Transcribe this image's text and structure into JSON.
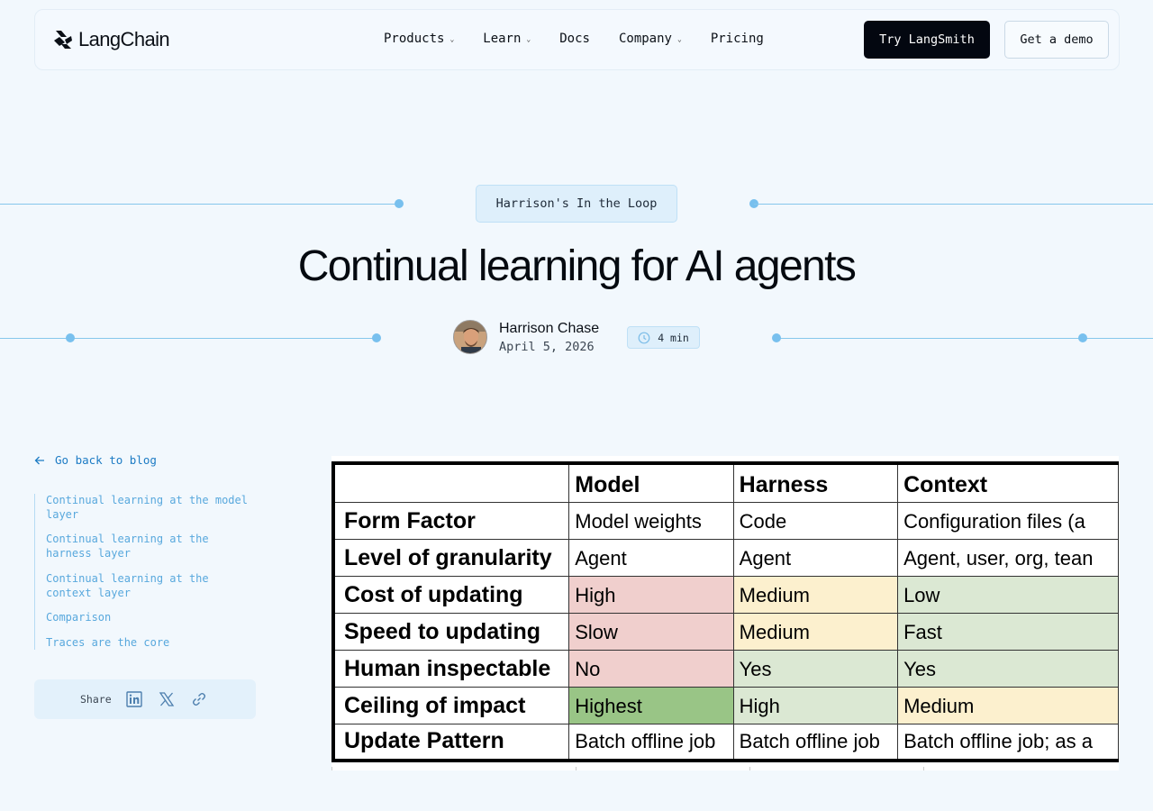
{
  "nav": {
    "logo_text": "LangChain",
    "menu": [
      {
        "label": "Products",
        "dropdown": true
      },
      {
        "label": "Learn",
        "dropdown": true
      },
      {
        "label": "Docs",
        "dropdown": false
      },
      {
        "label": "Company",
        "dropdown": true
      },
      {
        "label": "Pricing",
        "dropdown": false
      }
    ],
    "try_button": "Try LangSmith",
    "demo_button": "Get a demo"
  },
  "hero": {
    "tag": "Harrison's In the Loop",
    "title": "Continual learning for AI agents",
    "author_name": "Harrison Chase",
    "date": "April 5, 2026",
    "read_time": "4 min"
  },
  "sidebar": {
    "back_label": "Go back to blog",
    "toc": [
      {
        "label": "Continual learning at the model layer"
      },
      {
        "label": "Continual learning at the harness layer"
      },
      {
        "label": "Continual learning at the context layer"
      },
      {
        "label": "Comparison"
      },
      {
        "label": "Traces are the core"
      }
    ],
    "share_label": "Share"
  },
  "table": {
    "headers": [
      "",
      "Model",
      "Harness",
      "Context"
    ],
    "rows": [
      {
        "label": "Form Factor",
        "cells": [
          "Model weights",
          "Code",
          "Configuration files (a"
        ],
        "colors": [
          "",
          "",
          ""
        ]
      },
      {
        "label": "Level of granularity",
        "cells": [
          "Agent",
          "Agent",
          "Agent, user, org, tean"
        ],
        "colors": [
          "",
          "",
          ""
        ]
      },
      {
        "label": "Cost of updating",
        "cells": [
          "High",
          "Medium",
          "Low"
        ],
        "colors": [
          "red",
          "yellow",
          "lgreen"
        ]
      },
      {
        "label": "Speed to updating",
        "cells": [
          "Slow",
          "Medium",
          "Fast"
        ],
        "colors": [
          "red",
          "yellow",
          "lgreen"
        ]
      },
      {
        "label": "Human inspectable",
        "cells": [
          "No",
          "Yes",
          "Yes"
        ],
        "colors": [
          "red",
          "lgreen",
          "lgreen"
        ]
      },
      {
        "label": "Ceiling of impact",
        "cells": [
          "Highest",
          "High",
          "Medium"
        ],
        "colors": [
          "dgreen",
          "lgreen",
          "yellow"
        ]
      },
      {
        "label": "Update Pattern",
        "cells": [
          "Batch offline job",
          "Batch offline job",
          "Batch offline job; as a"
        ],
        "colors": [
          "",
          "",
          ""
        ]
      }
    ]
  },
  "colors": {
    "background": "#f2f8fd",
    "primary_button": "#030710",
    "accent_link": "#1c7bc4",
    "decor_line": "#86c7ec",
    "cell_red": "#f0cfcd",
    "cell_yellow": "#fcf0ce",
    "cell_light_green": "#dbe8d3",
    "cell_dark_green": "#99c586"
  },
  "icons": [
    "langchain-logo-icon",
    "chevron-down-icon",
    "arrow-left-icon",
    "clock-icon",
    "linkedin-icon",
    "x-icon",
    "link-icon"
  ]
}
